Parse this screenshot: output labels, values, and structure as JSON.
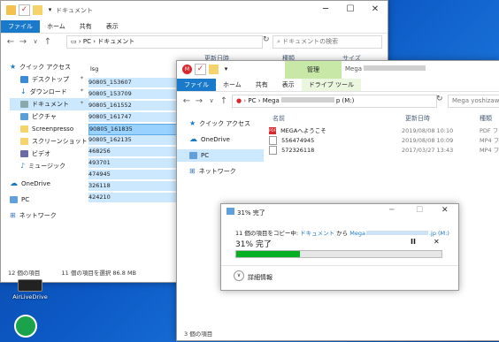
{
  "win1": {
    "title": "ドキュメント",
    "tabs": [
      "ファイル",
      "ホーム",
      "共有",
      "表示"
    ],
    "path": [
      "PC",
      "ドキュメント"
    ],
    "search_placeholder": "ドキュメントの検索",
    "headers": [
      "更新日時",
      "種類",
      "サイズ"
    ],
    "quick_access": "クイック アクセス",
    "nav": [
      "デスクトップ",
      "ダウンロード",
      "ドキュメント",
      "ピクチャ",
      "Screenpresso",
      "スクリーンショット",
      "ビデオ",
      "ミュージック"
    ],
    "onedrive": "OneDrive",
    "pc": "PC",
    "network": "ネットワーク",
    "files": [
      "lsg",
      "90805_153607",
      "90805_153709",
      "90805_161552",
      "90805_161747",
      "90805_161835",
      "90805_162135",
      "468256",
      "493701",
      "474945",
      "326118",
      "424210"
    ],
    "status_count": "12 個の項目",
    "status_selected": "11 個の項目を選択 86.8 MB"
  },
  "win2": {
    "title": "Mega",
    "title_obscured": "",
    "manage_tab": "管理",
    "drive_tool_tab": "ドライブ ツール",
    "tabs": [
      "ファイル",
      "ホーム",
      "共有",
      "表示"
    ],
    "path": [
      "PC",
      "Mega",
      "p (M:)"
    ],
    "search_placeholder": "Mega yoshizawa@",
    "headers": [
      "名前",
      "更新日時",
      "種類"
    ],
    "quick_access": "クイック アクセス",
    "onedrive": "OneDrive",
    "pc": "PC",
    "network": "ネットワーク",
    "files": [
      {
        "name": "MEGAへようこそ",
        "date": "2019/08/08 10:10",
        "type": "PDF ファ",
        "icon": "pdf-icon"
      },
      {
        "name": "556474945",
        "date": "2019/08/08 10:09",
        "type": "MP4 ファ",
        "icon": "mp4-icon"
      },
      {
        "name": "572326118",
        "date": "2017/03/27 13:43",
        "type": "MP4 ファ",
        "icon": "mp4-icon"
      }
    ],
    "status_count": "3 個の項目"
  },
  "progress": {
    "title": "31% 完了",
    "line_prefix": "11 個の項目をコピー中: ",
    "line_src": "ドキュメント",
    "line_mid": " から ",
    "line_dst": "Mega",
    "line_dst_suffix": ".jp (M:)",
    "percent_text": "31% 完了",
    "progress": 0.31,
    "details": "詳細情報",
    "pause": "II",
    "cancel": "✕"
  },
  "desktop": {
    "icon_label": "AirLiveDrive"
  },
  "colors": {
    "accent": "#1979ca",
    "progress_fill": "#06b025",
    "manage_tab_bg": "#c8e8a8"
  }
}
